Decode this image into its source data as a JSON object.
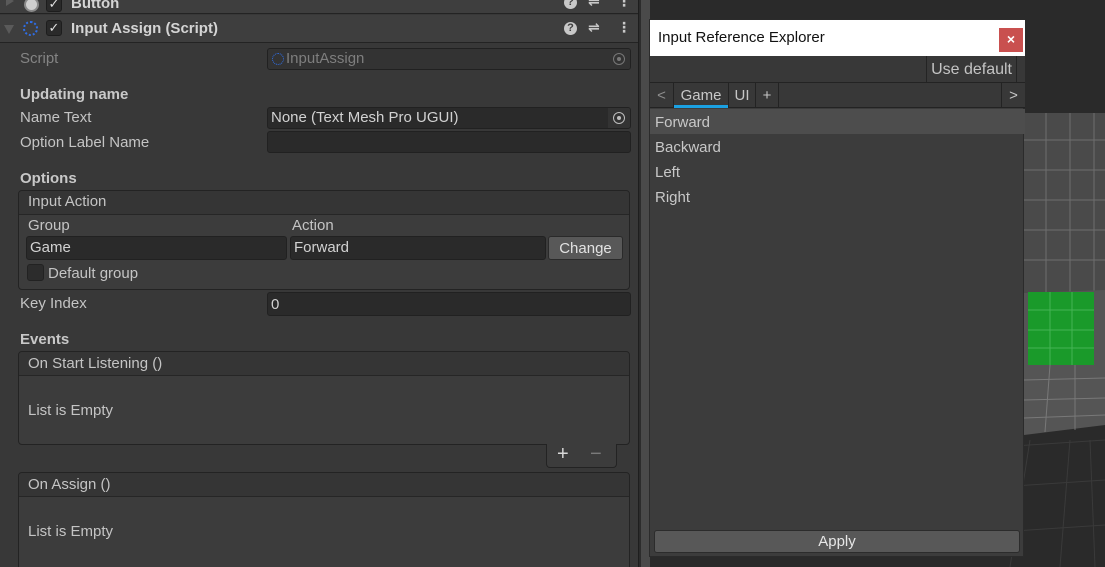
{
  "inspector": {
    "prev_component": {
      "title": "Button",
      "enabled": true
    },
    "component": {
      "title": "Input Assign (Script)",
      "enabled": true,
      "icons": [
        "help-icon",
        "presets-icon",
        "kebab-menu-icon"
      ]
    },
    "script": {
      "label": "Script",
      "value": "InputAssign"
    },
    "updating_name": {
      "header": "Updating name",
      "name_text": {
        "label": "Name Text",
        "value": "None (Text Mesh Pro UGUI)"
      },
      "option_label_name": {
        "label": "Option Label Name",
        "value": ""
      }
    },
    "options": {
      "header": "Options",
      "input_action": {
        "title": "Input Action",
        "group_label": "Group",
        "action_label": "Action",
        "group_value": "Game",
        "action_value": "Forward",
        "change_label": "Change",
        "default_group": {
          "label": "Default group",
          "checked": false
        }
      },
      "key_index": {
        "label": "Key Index",
        "value": "0"
      }
    },
    "events": {
      "header": "Events",
      "lists": [
        {
          "title": "On Start Listening ()",
          "empty_text": "List is Empty"
        },
        {
          "title": "On Assign ()",
          "empty_text": "List is Empty"
        }
      ],
      "add_label": "+",
      "remove_label": "−"
    }
  },
  "explorer": {
    "title": "Input Reference Explorer",
    "close_label": "×",
    "use_default_label": "Use default",
    "tabs": {
      "prev_label": "<",
      "next_label": ">",
      "add_label": "+",
      "items": [
        {
          "label": "Game",
          "active": true
        },
        {
          "label": "UI",
          "active": false
        }
      ]
    },
    "items": [
      {
        "label": "Forward",
        "selected": true
      },
      {
        "label": "Backward",
        "selected": false
      },
      {
        "label": "Left",
        "selected": false
      },
      {
        "label": "Right",
        "selected": false
      }
    ],
    "apply_label": "Apply"
  },
  "colors": {
    "accent_tab": "#1ba1e2",
    "close_button": "#c9504f",
    "script_icon": "#2f6ee6",
    "scene_cube": "#1a9a2a"
  }
}
